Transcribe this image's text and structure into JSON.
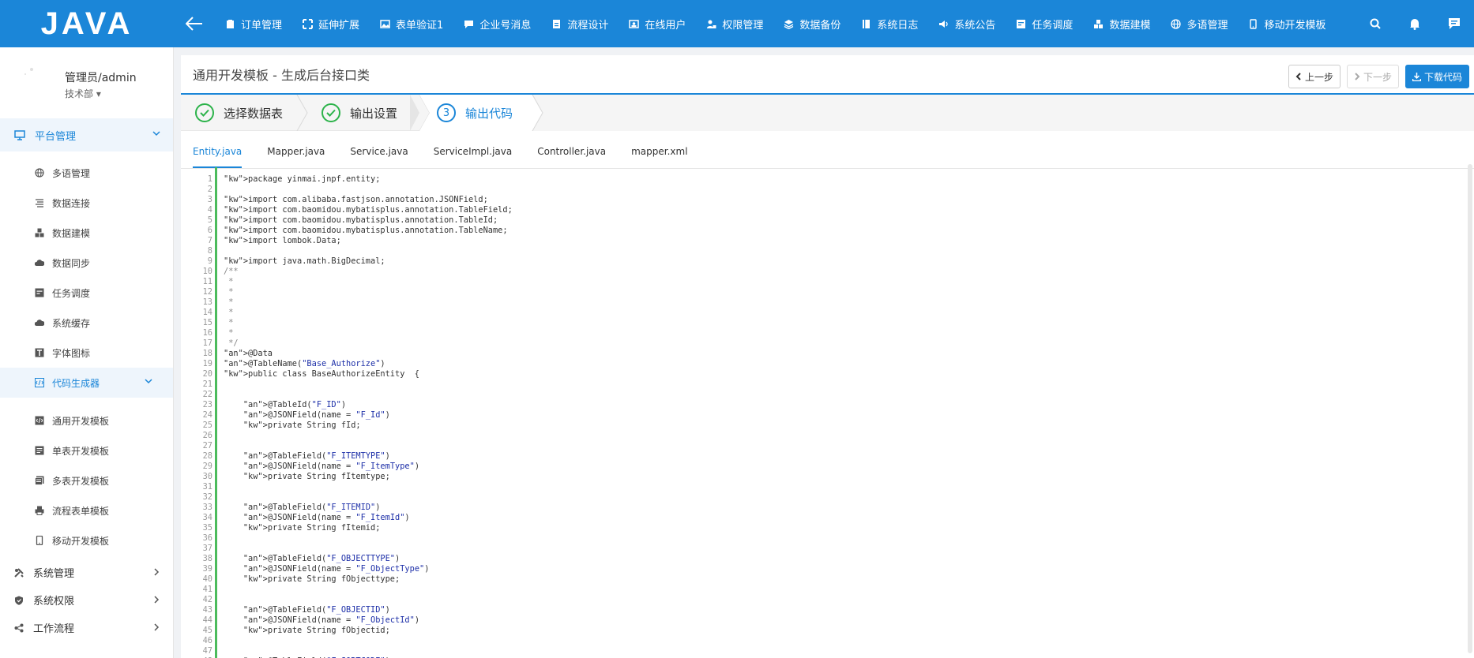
{
  "app": {
    "logo": "JAVA"
  },
  "topnav": [
    {
      "label": "订单管理",
      "icon": "clipboard-icon"
    },
    {
      "label": "延伸扩展",
      "icon": "expand-icon"
    },
    {
      "label": "表单验证1",
      "icon": "image-icon"
    },
    {
      "label": "企业号消息",
      "icon": "message-icon"
    },
    {
      "label": "流程设计",
      "icon": "document-icon"
    },
    {
      "label": "在线用户",
      "icon": "user-card-icon"
    },
    {
      "label": "权限管理",
      "icon": "user-lock-icon"
    },
    {
      "label": "数据备份",
      "icon": "layers-icon"
    },
    {
      "label": "系统日志",
      "icon": "book-icon"
    },
    {
      "label": "系统公告",
      "icon": "speaker-icon"
    },
    {
      "label": "任务调度",
      "icon": "schedule-icon"
    },
    {
      "label": "数据建模",
      "icon": "cubes-icon"
    },
    {
      "label": "多语管理",
      "icon": "globe-icon"
    },
    {
      "label": "移动开发模板",
      "icon": "mobile-icon"
    }
  ],
  "user": {
    "name": "管理员/admin",
    "dept": "技术部"
  },
  "sidebar": {
    "group_platform": "平台管理",
    "platform_items": [
      {
        "label": "多语管理",
        "icon": "globe-icon"
      },
      {
        "label": "数据连接",
        "icon": "list-icon"
      },
      {
        "label": "数据建模",
        "icon": "cubes-icon"
      },
      {
        "label": "数据同步",
        "icon": "cloud-icon"
      },
      {
        "label": "任务调度",
        "icon": "schedule-icon"
      },
      {
        "label": "系统缓存",
        "icon": "cloud-icon"
      },
      {
        "label": "字体图标",
        "icon": "font-icon"
      }
    ],
    "codegen": "代码生成器",
    "codegen_items": [
      {
        "label": "通用开发模板",
        "icon": "code-file-icon"
      },
      {
        "label": "单表开发模板",
        "icon": "form-icon"
      },
      {
        "label": "多表开发模板",
        "icon": "multi-form-icon"
      },
      {
        "label": "流程表单模板",
        "icon": "print-icon"
      },
      {
        "label": "移动开发模板",
        "icon": "mobile-icon"
      }
    ],
    "groups": [
      {
        "label": "系统管理",
        "icon": "tools-icon"
      },
      {
        "label": "系统权限",
        "icon": "shield-icon"
      },
      {
        "label": "工作流程",
        "icon": "share-icon"
      }
    ]
  },
  "page": {
    "title": "通用开发模板 - 生成后台接口类",
    "prev": "上一步",
    "next": "下一步",
    "download": "下载代码"
  },
  "steps": [
    {
      "label": "选择数据表",
      "state": "done"
    },
    {
      "label": "输出设置",
      "state": "done"
    },
    {
      "label": "输出代码",
      "state": "current",
      "num": "3"
    }
  ],
  "tabs": [
    "Entity.java",
    "Mapper.java",
    "Service.java",
    "ServiceImpl.java",
    "Controller.java",
    "mapper.xml"
  ],
  "active_tab": "Entity.java",
  "code": [
    "package yinmai.jnpf.entity;",
    "",
    "import com.alibaba.fastjson.annotation.JSONField;",
    "import com.baomidou.mybatisplus.annotation.TableField;",
    "import com.baomidou.mybatisplus.annotation.TableId;",
    "import com.baomidou.mybatisplus.annotation.TableName;",
    "import lombok.Data;",
    "",
    "import java.math.BigDecimal;",
    "/**",
    " *",
    " *",
    " *",
    " *",
    " *",
    " *",
    " */",
    "@Data",
    "@TableName(\"Base_Authorize\")",
    "public class BaseAuthorizeEntity  {",
    "",
    "",
    "    @TableId(\"F_ID\")",
    "    @JSONField(name = \"F_Id\")",
    "    private String fId;",
    "",
    "",
    "    @TableField(\"F_ITEMTYPE\")",
    "    @JSONField(name = \"F_ItemType\")",
    "    private String fItemtype;",
    "",
    "",
    "    @TableField(\"F_ITEMID\")",
    "    @JSONField(name = \"F_ItemId\")",
    "    private String fItemid;",
    "",
    "",
    "    @TableField(\"F_OBJECTTYPE\")",
    "    @JSONField(name = \"F_ObjectType\")",
    "    private String fObjecttype;",
    "",
    "",
    "    @TableField(\"F_OBJECTID\")",
    "    @JSONField(name = \"F_ObjectId\")",
    "    private String fObjectid;",
    "",
    "",
    "    @TableField(\"F_SORTCODE\")"
  ],
  "colors": {
    "primary": "#1b86d8",
    "success": "#2cb34a"
  }
}
